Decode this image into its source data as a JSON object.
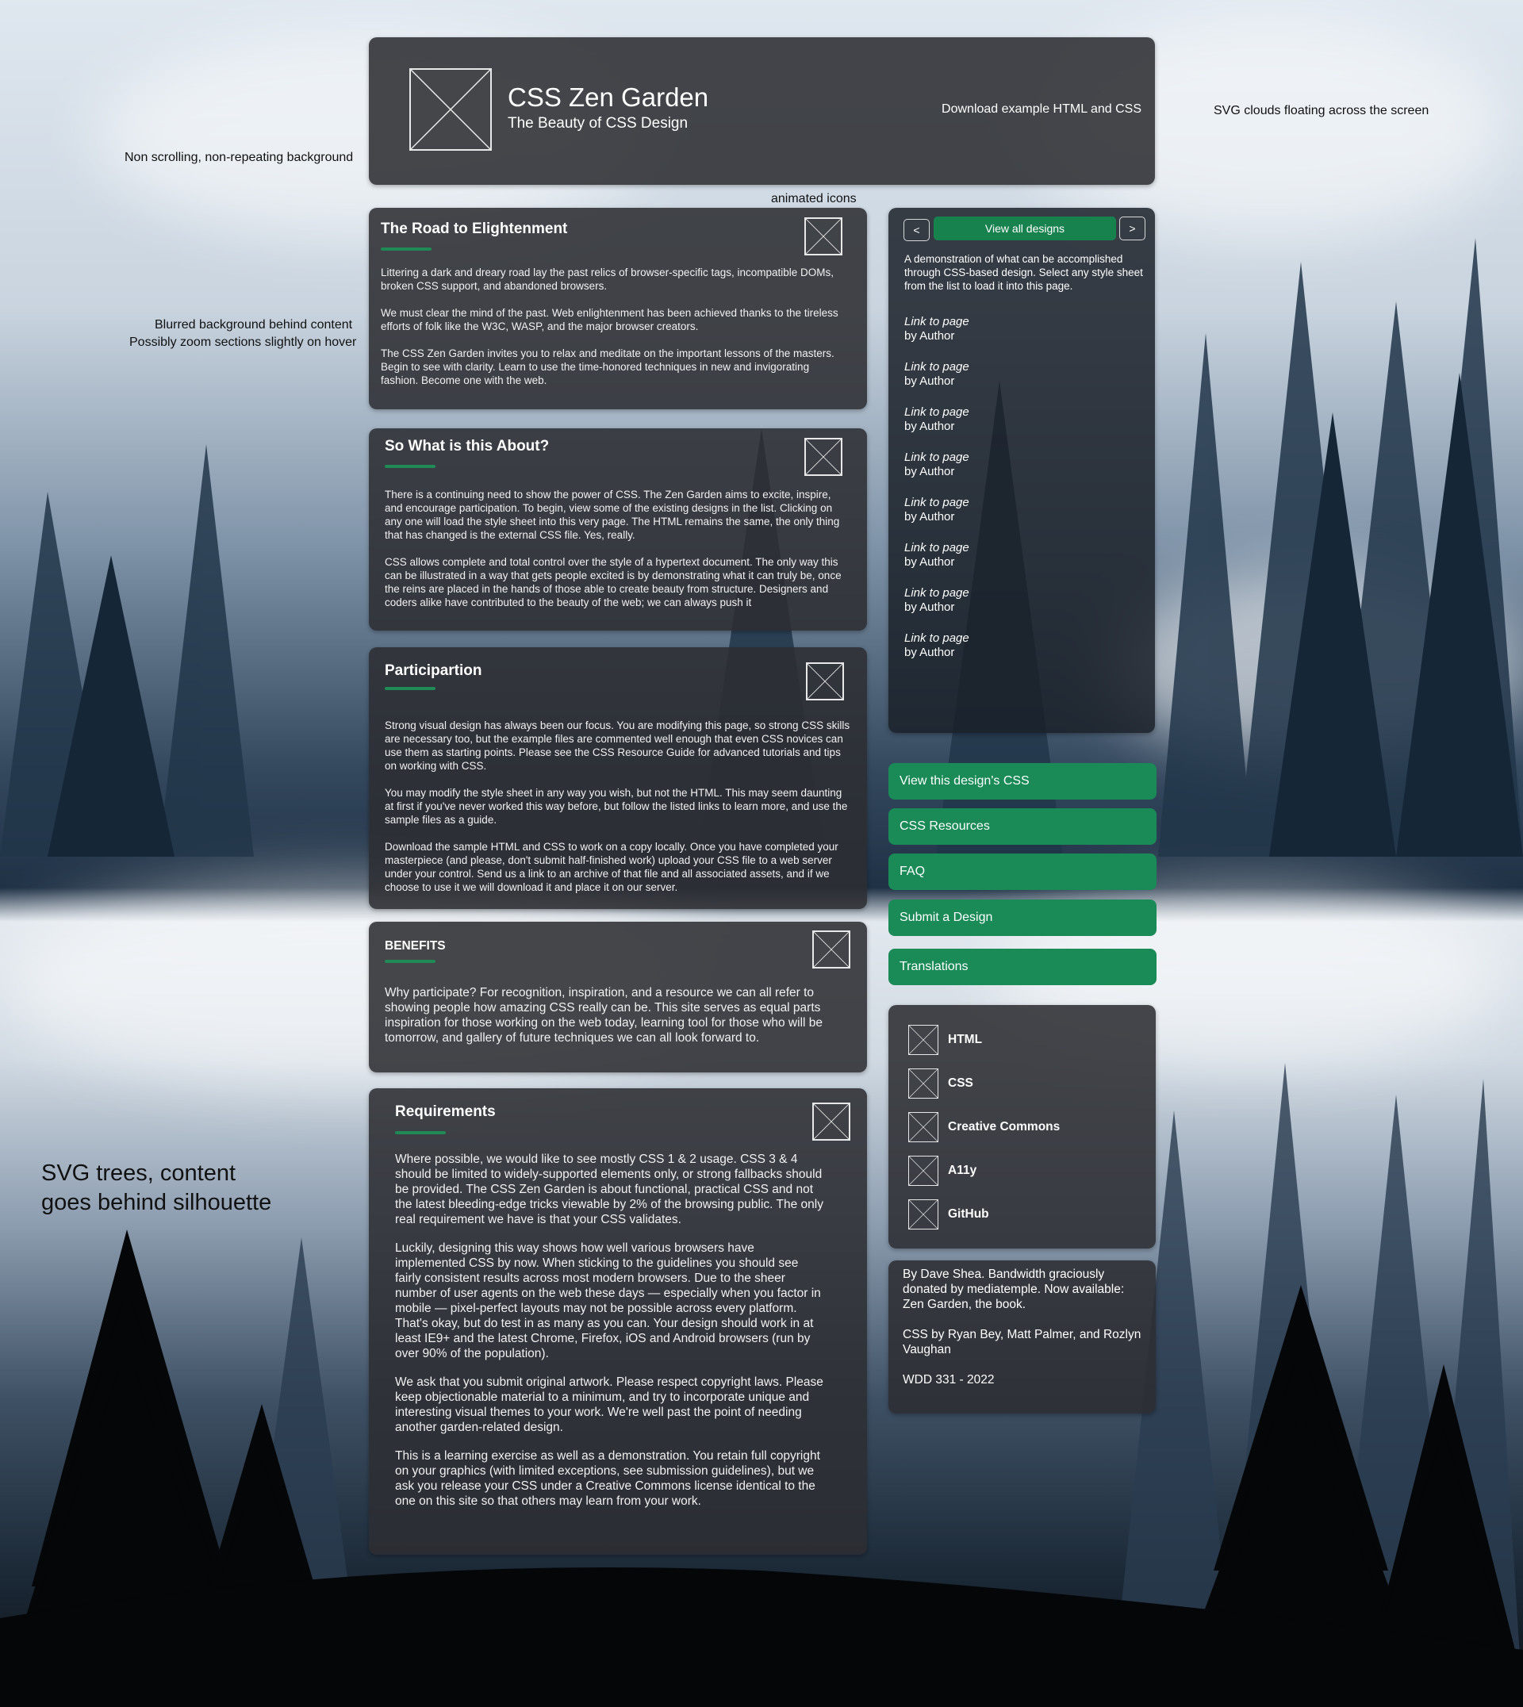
{
  "annotations": {
    "background": "Non scrolling, non-repeating background",
    "clouds": "SVG clouds floating across the screen",
    "icons": "animated icons",
    "blur_line1": "Blurred background behind content",
    "blur_line2": "Possibly zoom sections slightly on hover",
    "trees_line1": "SVG trees, content",
    "trees_line2": "goes behind silhouette"
  },
  "header": {
    "title": "CSS Zen Garden",
    "subtitle": "The Beauty of CSS Design",
    "download": "Download example HTML and CSS"
  },
  "sections": {
    "road": {
      "title": "The Road to Elightenment",
      "paragraphs": [
        "Littering a dark and dreary road lay the past relics of browser-specific tags, incompatible DOMs, broken CSS support, and abandoned browsers.",
        "We must clear the mind of the past. Web enlightenment has been achieved thanks to the tireless efforts of folk like the W3C, WASP, and the major browser creators.",
        "The CSS Zen Garden invites you to relax and meditate on the important lessons of the masters. Begin to see with clarity. Learn to use the time-honored techniques in new and invigorating fashion. Become one with the web."
      ]
    },
    "about": {
      "title": "So What is this About?",
      "paragraphs": [
        "There is a continuing need to show the power of CSS. The Zen Garden aims to excite, inspire, and encourage participation. To begin, view some of the existing designs in the list. Clicking on any one will load the style sheet into this very page. The HTML remains the same, the only thing that has changed is the external CSS file. Yes, really.",
        "CSS allows complete and total control over the style of a hypertext document. The only way this can be illustrated in a way that gets people excited is by demonstrating what it can truly be, once the reins are placed in the hands of those able to create beauty from structure. Designers and coders alike have contributed to the beauty of the web; we can always push it"
      ]
    },
    "participation": {
      "title": "Participartion",
      "paragraphs": [
        "Strong visual design has always been our focus. You are modifying this page, so strong CSS skills are necessary too, but the example files are commented well enough that even CSS novices can use them as starting points. Please see the CSS Resource Guide for advanced tutorials and tips on working with CSS.",
        "You may modify the style sheet in any way you wish, but not the HTML. This may seem daunting at first if you've never worked this way before, but follow the listed links to learn more, and use the sample files as a guide.",
        "Download the sample HTML and CSS to work on a copy locally. Once you have completed your masterpiece (and please, don't submit half-finished work) upload your CSS file to a web server under your control. Send us a link to an archive of that file and all associated assets, and if we choose to use it we will download it and place it on our server."
      ]
    },
    "benefits": {
      "title": "BENEFITS",
      "paragraphs": [
        "Why participate? For recognition, inspiration, and a resource we can all refer to showing people how amazing CSS really can be. This site serves as equal parts inspiration for those working on the web today, learning tool for those who will be tomorrow, and gallery of future techniques we can all look forward to."
      ]
    },
    "requirements": {
      "title": "Requirements",
      "paragraphs": [
        "Where possible, we would like to see mostly CSS 1 & 2 usage. CSS 3 & 4 should be limited to widely-supported elements only, or strong fallbacks should be provided. The CSS Zen Garden is about functional, practical CSS and not the latest bleeding-edge tricks viewable by 2% of the browsing public. The only real requirement we have is that your CSS validates.",
        "Luckily, designing this way shows how well various browsers have implemented CSS by now. When sticking to the guidelines you should see fairly consistent results across most modern browsers. Due to the sheer number of user agents on the web these days — especially when you factor in mobile — pixel-perfect layouts may not be possible across every platform. That's okay, but do test in as many as you can. Your design should work in at least IE9+ and the latest Chrome, Firefox, iOS and Android browsers (run by over 90% of the population).",
        "We ask that you submit original artwork. Please respect copyright laws. Please keep objectionable material to a minimum, and try to incorporate unique and interesting visual themes to your work. We're well past the point of needing another garden-related design.",
        "This is a learning exercise as well as a demonstration. You retain full copyright on your graphics (with limited exceptions, see submission guidelines), but we ask you release your CSS under a Creative Commons license identical to the one on this site so that others may learn from your work."
      ]
    }
  },
  "design_nav": {
    "prev": "<",
    "next": ">",
    "view_all": "View all designs",
    "description": "A demonstration of what can be accomplished through CSS-based design. Select any style sheet from the list to load it into this page.",
    "links": [
      {
        "page": "Link to page",
        "author": "by Author"
      },
      {
        "page": "Link to page",
        "author": "by Author"
      },
      {
        "page": "Link to page",
        "author": "by Author"
      },
      {
        "page": "Link to page",
        "author": "by Author"
      },
      {
        "page": "Link to page",
        "author": "by Author"
      },
      {
        "page": "Link to page",
        "author": "by Author"
      },
      {
        "page": "Link to page",
        "author": "by Author"
      },
      {
        "page": "Link to page",
        "author": "by Author"
      }
    ]
  },
  "side_buttons": [
    "View this design's CSS",
    "CSS Resources",
    "FAQ",
    "Submit a Design",
    "Translations"
  ],
  "resources": [
    "HTML",
    "CSS",
    "Creative Commons",
    "A11y",
    "GitHub"
  ],
  "footer": {
    "line1": "By Dave Shea. Bandwidth graciously donated by mediatemple. Now available: Zen Garden, the book.",
    "line2": "CSS by Ryan Bey, Matt Palmer, and Rozlyn Vaughan",
    "line3": "WDD 331 - 2022"
  },
  "colors": {
    "accent": "#1f8a55",
    "panel": "#2c2e32"
  }
}
